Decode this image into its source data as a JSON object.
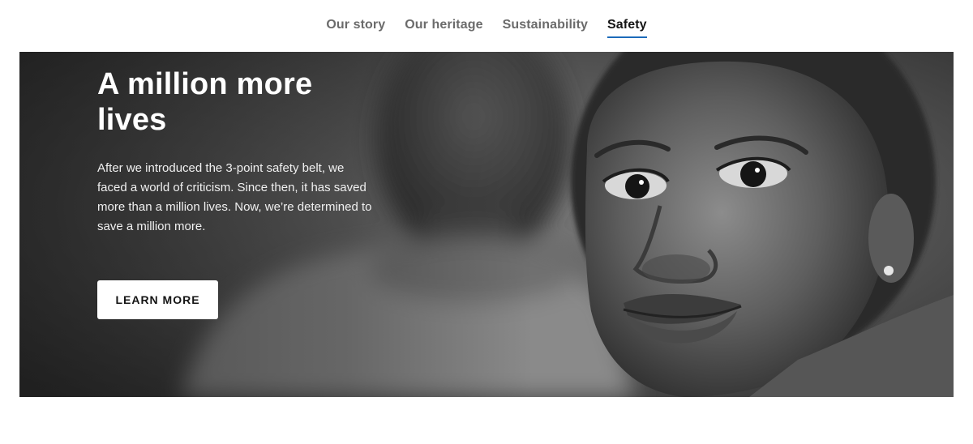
{
  "nav": {
    "tabs": [
      {
        "label": "Our story",
        "active": false
      },
      {
        "label": "Our heritage",
        "active": false
      },
      {
        "label": "Sustainability",
        "active": false
      },
      {
        "label": "Safety",
        "active": true
      }
    ],
    "accent_color": "#1c6bba"
  },
  "hero": {
    "title": "A million more lives",
    "body": "After we introduced the 3-point safety belt, we faced a world of criticism. Since then, it has saved more than a million lives. Now, we’re determined to save a million more.",
    "button_label": "LEARN MORE",
    "image_style": "black-and-white"
  }
}
